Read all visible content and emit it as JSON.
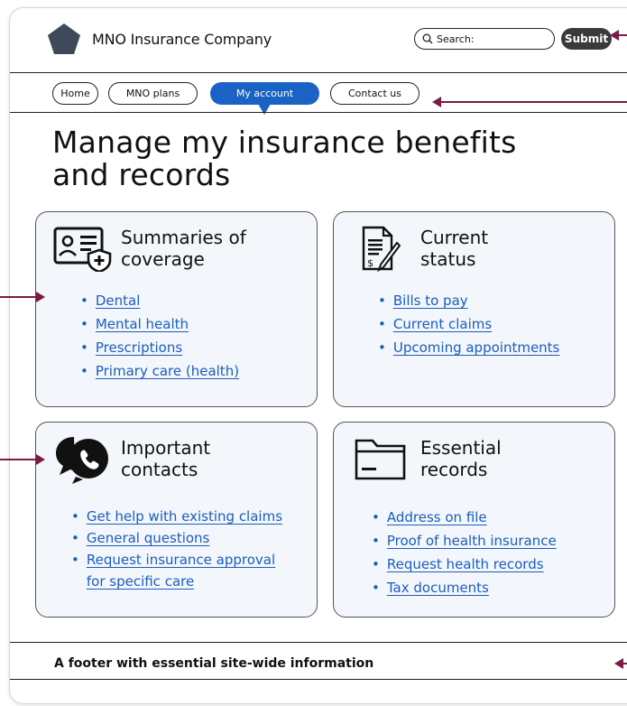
{
  "header": {
    "company_name": "MNO Insurance Company",
    "search_label": "Search:",
    "submit_label": "Submit"
  },
  "nav": {
    "items": [
      {
        "label": "Home"
      },
      {
        "label": "MNO plans"
      },
      {
        "label": "My account",
        "active": true
      },
      {
        "label": "Contact us"
      }
    ]
  },
  "page": {
    "title_line1": "Manage my insurance benefits",
    "title_line2": "and records"
  },
  "cards": {
    "summaries": {
      "title_line1": "Summaries of",
      "title_line2": "coverage",
      "links": [
        "Dental",
        "Mental health",
        "Prescriptions",
        "Primary care (health)"
      ]
    },
    "status": {
      "title_line1": "Current",
      "title_line2": "status",
      "links": [
        "Bills to pay",
        "Current claims",
        "Upcoming appointments"
      ]
    },
    "contacts": {
      "title_line1": "Important",
      "title_line2": "contacts",
      "links": [
        "Get help with existing claims",
        "General questions",
        "Request insurance approval",
        "for specific care"
      ]
    },
    "records": {
      "title_line1": "Essential",
      "title_line2": "records",
      "links": [
        "Address on file",
        "Proof of health insurance",
        "Request health records",
        "Tax documents"
      ]
    }
  },
  "footer": {
    "text": "A footer with essential site-wide information"
  },
  "colors": {
    "accent": "#1a63c5",
    "link": "#1a5ebd",
    "card_bg": "#f3f6fa",
    "annotation_arrow": "#7a1a45"
  }
}
